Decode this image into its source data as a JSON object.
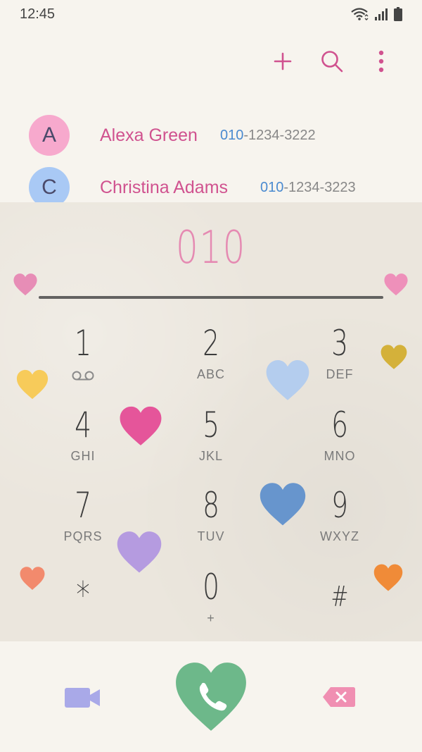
{
  "status_bar": {
    "time": "12:45"
  },
  "icons": {
    "add": "plus-icon",
    "search": "search-icon",
    "more": "more-vertical-icon",
    "voicemail": "voicemail-icon",
    "video": "video-call-icon",
    "call": "phone-icon",
    "backspace": "backspace-icon"
  },
  "contacts": [
    {
      "initial": "A",
      "name": "Alexa Green",
      "number_match": "010",
      "number_rest": "-1234-3222",
      "avatar_color": "#f7a9cd"
    },
    {
      "initial": "C",
      "name": "Christina Adams",
      "number_match": "010",
      "number_rest": "-1234-3223",
      "avatar_color": "#a9c9f5"
    }
  ],
  "dialer": {
    "display": "010",
    "keys": [
      {
        "digit": "1",
        "letters": ""
      },
      {
        "digit": "2",
        "letters": "ABC"
      },
      {
        "digit": "3",
        "letters": "DEF"
      },
      {
        "digit": "4",
        "letters": "GHI"
      },
      {
        "digit": "5",
        "letters": "JKL"
      },
      {
        "digit": "6",
        "letters": "MNO"
      },
      {
        "digit": "7",
        "letters": "PQRS"
      },
      {
        "digit": "8",
        "letters": "TUV"
      },
      {
        "digit": "9",
        "letters": "WXYZ"
      },
      {
        "digit": "*",
        "letters": ""
      },
      {
        "digit": "0",
        "letters": "+"
      },
      {
        "digit": "#",
        "letters": ""
      }
    ]
  },
  "colors": {
    "accent_pink": "#d0528f",
    "match_blue": "#4a8ad0",
    "call_green": "#6db88a",
    "video_purple": "#a9a9e8",
    "backspace_pink": "#f08fb2"
  }
}
